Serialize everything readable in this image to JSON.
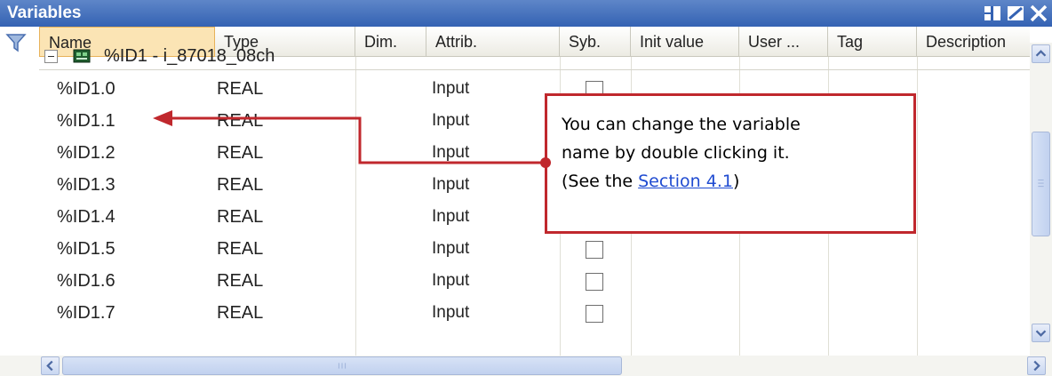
{
  "window": {
    "title": "Variables",
    "buttons": [
      {
        "name": "layout",
        "icon": "split-icon"
      },
      {
        "name": "edit",
        "icon": "edit-icon"
      },
      {
        "name": "close",
        "icon": "close-icon"
      }
    ]
  },
  "columns": [
    "Name",
    "Type",
    "Dim.",
    "Attrib.",
    "Syb.",
    "Init value",
    "User ...",
    "Tag",
    "Description"
  ],
  "group": {
    "label": "%ID1 - i_87018_08ch",
    "expanded": true,
    "icon": "io-board-icon"
  },
  "rows": [
    {
      "name": "%ID1.0",
      "type": "REAL",
      "attrib": "Input",
      "syb": false
    },
    {
      "name": "%ID1.1",
      "type": "REAL",
      "attrib": "Input",
      "syb": false
    },
    {
      "name": "%ID1.2",
      "type": "REAL",
      "attrib": "Input",
      "syb": false
    },
    {
      "name": "%ID1.3",
      "type": "REAL",
      "attrib": "Input",
      "syb": false
    },
    {
      "name": "%ID1.4",
      "type": "REAL",
      "attrib": "Input",
      "syb": false
    },
    {
      "name": "%ID1.5",
      "type": "REAL",
      "attrib": "Input",
      "syb": false
    },
    {
      "name": "%ID1.6",
      "type": "REAL",
      "attrib": "Input",
      "syb": false
    },
    {
      "name": "%ID1.7",
      "type": "REAL",
      "attrib": "Input",
      "syb": false
    }
  ],
  "callout": {
    "line1": "You can change the variable",
    "line2": "name by double clicking it.",
    "line3_prefix": "(See the ",
    "link": "Section 4.1",
    "line3_suffix": ")"
  },
  "colors": {
    "titlebar": "#3462b3",
    "callout_border": "#c0282d",
    "link": "#1f4bd1"
  }
}
